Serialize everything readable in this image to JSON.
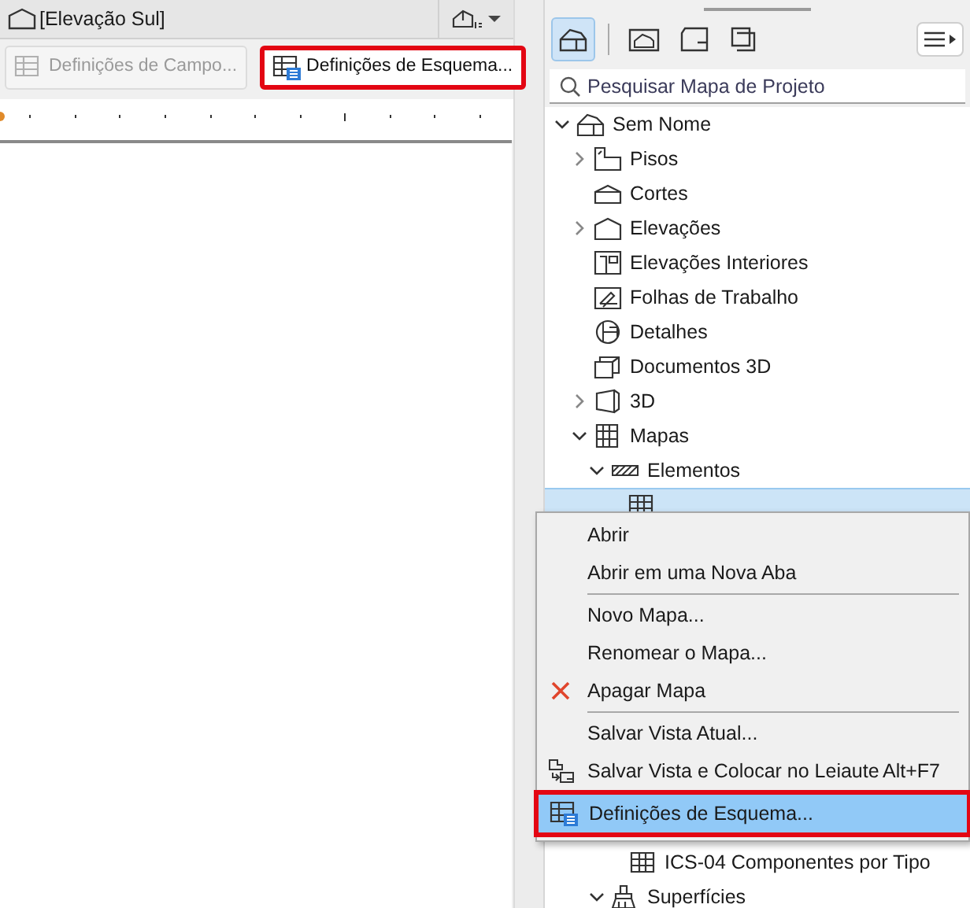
{
  "view_tab": {
    "title": "[Elevação Sul]"
  },
  "toolbar": {
    "buttons": [
      {
        "label": "Definições de Campo...",
        "disabled": true,
        "callout": false
      },
      {
        "label": "Definições de Esquema...",
        "disabled": false,
        "callout": true
      }
    ]
  },
  "navigator": {
    "tabs": [
      {
        "kind": "project",
        "selected": true
      },
      {
        "kind": "views",
        "selected": false
      },
      {
        "kind": "layouts",
        "selected": false
      },
      {
        "kind": "publisher",
        "selected": false
      }
    ],
    "search": {
      "placeholder": "Pesquisar Mapa de Projeto"
    },
    "tree": [
      {
        "kind": "project",
        "label": "Sem Nome",
        "expanded": true,
        "children": [
          {
            "kind": "floors",
            "label": "Pisos",
            "expanded": false
          },
          {
            "kind": "sections",
            "label": "Cortes"
          },
          {
            "kind": "elevations",
            "label": "Elevações",
            "expanded": false
          },
          {
            "kind": "interior",
            "label": "Elevações Interiores"
          },
          {
            "kind": "worksheets",
            "label": "Folhas de Trabalho"
          },
          {
            "kind": "details",
            "label": "Detalhes"
          },
          {
            "kind": "doc3d",
            "label": "Documentos 3D"
          },
          {
            "kind": "view3d",
            "label": "3D",
            "expanded": false
          },
          {
            "kind": "schedules",
            "label": "Mapas",
            "expanded": true,
            "children": [
              {
                "kind": "elements",
                "label": "Elementos",
                "expanded": true,
                "children": [
                  {
                    "kind": "schedule",
                    "selected": true
                  },
                  {
                    "kind": "schedule",
                    "label": "ICS-04 Componentes por Tipo",
                    "selected": false
                  }
                ]
              },
              {
                "kind": "surfaces",
                "label": "Superfícies",
                "expanded": true
              }
            ]
          }
        ]
      }
    ]
  },
  "context_menu": [
    {
      "kind": "item",
      "label": "Abrir",
      "selected": false
    },
    {
      "kind": "item",
      "label": "Abrir em uma Nova Aba",
      "selected": false
    },
    {
      "kind": "separator"
    },
    {
      "kind": "item",
      "label": "Novo Mapa...",
      "selected": false
    },
    {
      "kind": "item",
      "label": "Renomear o Mapa...",
      "selected": false
    },
    {
      "kind": "delete",
      "label": "Apagar Mapa",
      "selected": false
    },
    {
      "kind": "separator"
    },
    {
      "kind": "item",
      "label": "Salvar Vista Atual...",
      "selected": false
    },
    {
      "kind": "place",
      "label": "Salvar Vista e Colocar no Leiaute",
      "shortcut": "Alt+F7",
      "selected": false
    },
    {
      "kind": "settings",
      "label": "Definições de Esquema...",
      "selected": true,
      "callout": true
    }
  ]
}
